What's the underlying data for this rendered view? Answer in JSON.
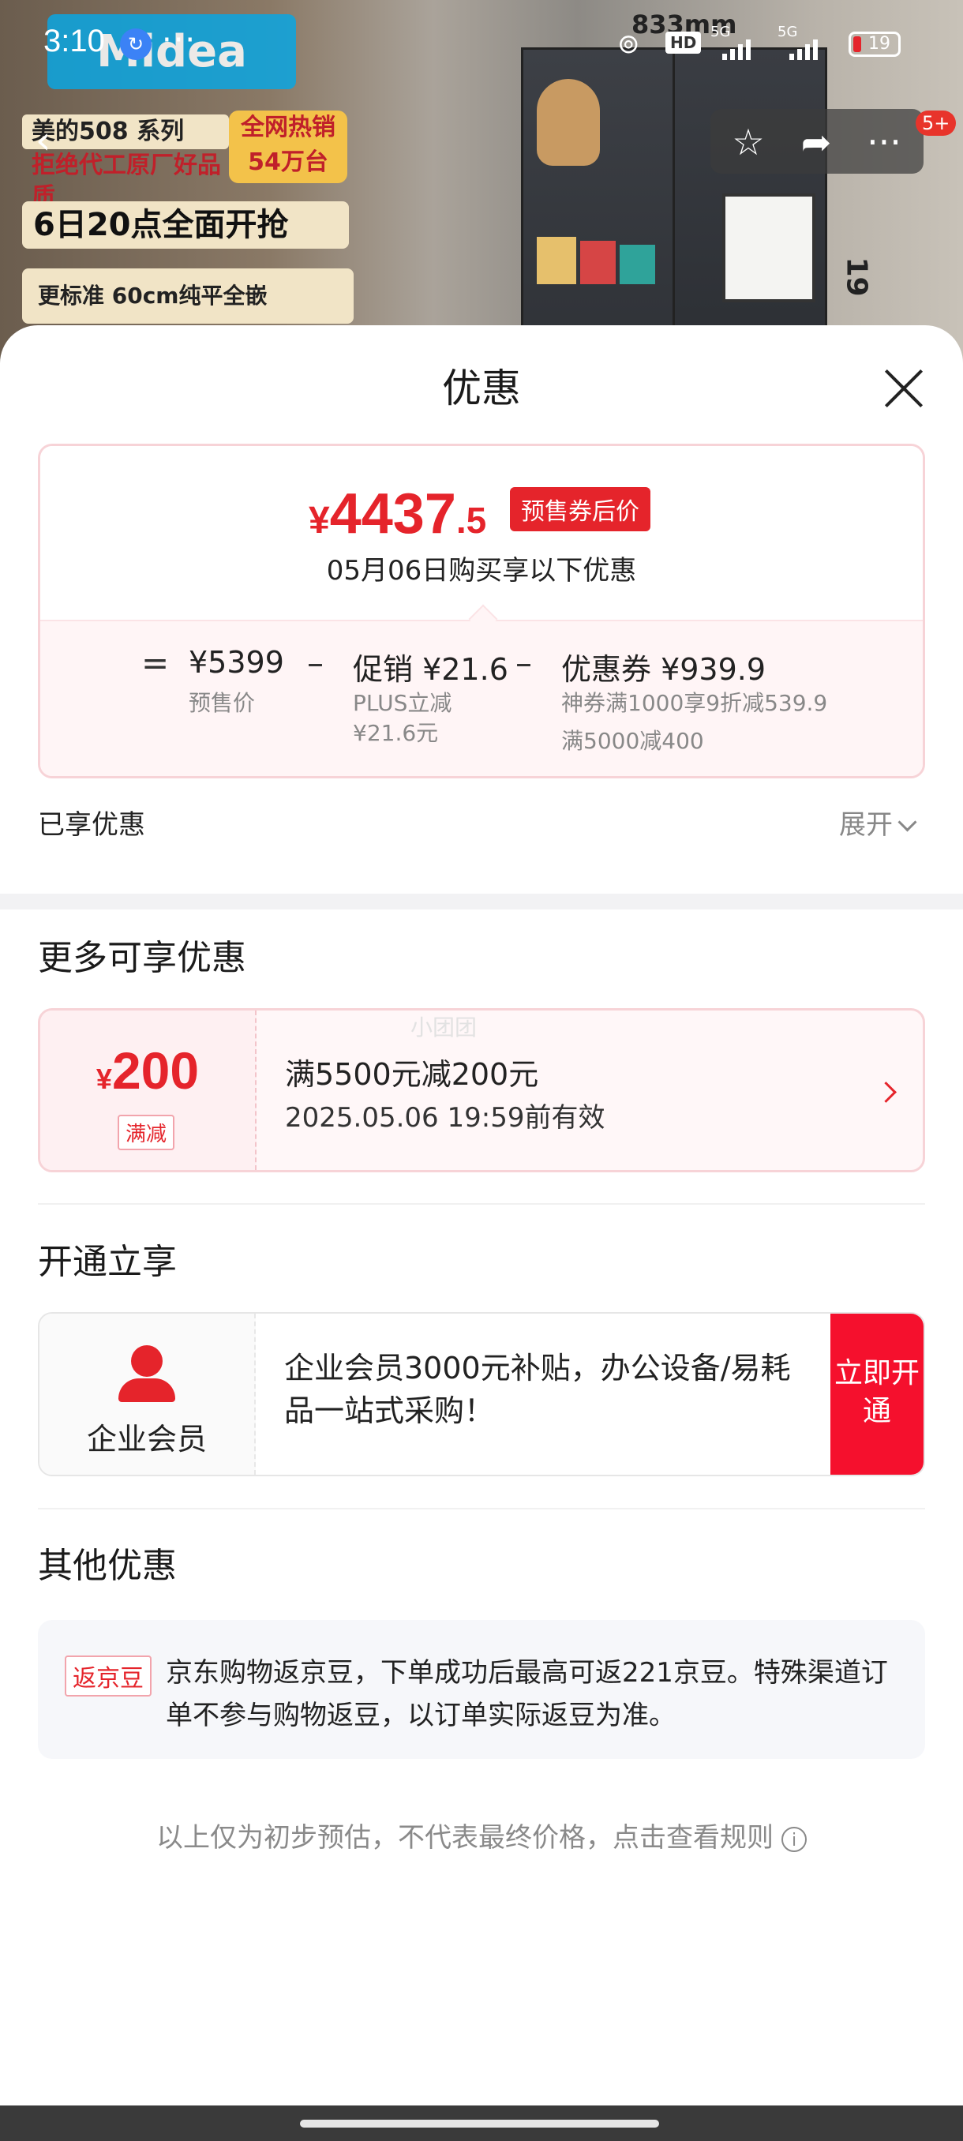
{
  "status_bar": {
    "time": "3:10",
    "signal1": "5G",
    "signal2": "5G",
    "battery": "19",
    "hd_label": "HD"
  },
  "banner": {
    "brand": "Midea",
    "series": "美的508 系列",
    "slogan": "拒绝代工原厂好品质",
    "hot": "全网热销54万台",
    "sale": "6日20点全面开抢",
    "standard": "更标准 60cm纯平全嵌",
    "dimension_top": "833mm",
    "dimension_side": "19",
    "badge": "5+"
  },
  "sheet": {
    "title": "优惠"
  },
  "price": {
    "yen": "¥",
    "integer": "4437",
    "decimal": ".5",
    "tag": "预售券后价",
    "date_line": "05月06日购买享以下优惠",
    "equals": "=",
    "minus1": "–",
    "minus2": "–",
    "presale_value": "¥5399",
    "presale_label": "预售价",
    "promo_value": "促销 ¥21.6",
    "promo_sub1": "PLUS立减",
    "promo_sub2": "¥21.6元",
    "coupon_value": "优惠券 ¥939.9",
    "coupon_sub1": "神券满1000享9折减539.9",
    "coupon_sub2": "满5000减400"
  },
  "enjoyed": {
    "label": "已享优惠",
    "expand": "展开"
  },
  "more": {
    "title": "更多可享优惠",
    "coupon_yen": "¥",
    "coupon_amount": "200",
    "coupon_kind": "满减",
    "coupon_desc": "满5500元减200元",
    "coupon_valid": "2025.05.06 19:59前有效",
    "watermark": "小团团"
  },
  "open": {
    "title": "开通立享",
    "member_name": "企业会员",
    "member_desc": "企业会员3000元补贴，办公设备/易耗品一站式采购！",
    "button": "立即开通"
  },
  "other": {
    "title": "其他优惠",
    "tag": "返京豆",
    "text": "京东购物返京豆，下单成功后最高可返221京豆。特殊渠道订单不参与购物返豆，以订单实际返豆为准。"
  },
  "footnote": {
    "text": "以上仅为初步预估，不代表最终价格，点击查看规则",
    "info_icon": "i"
  },
  "colors": {
    "accent": "#e5242b",
    "button": "#f5102d"
  }
}
